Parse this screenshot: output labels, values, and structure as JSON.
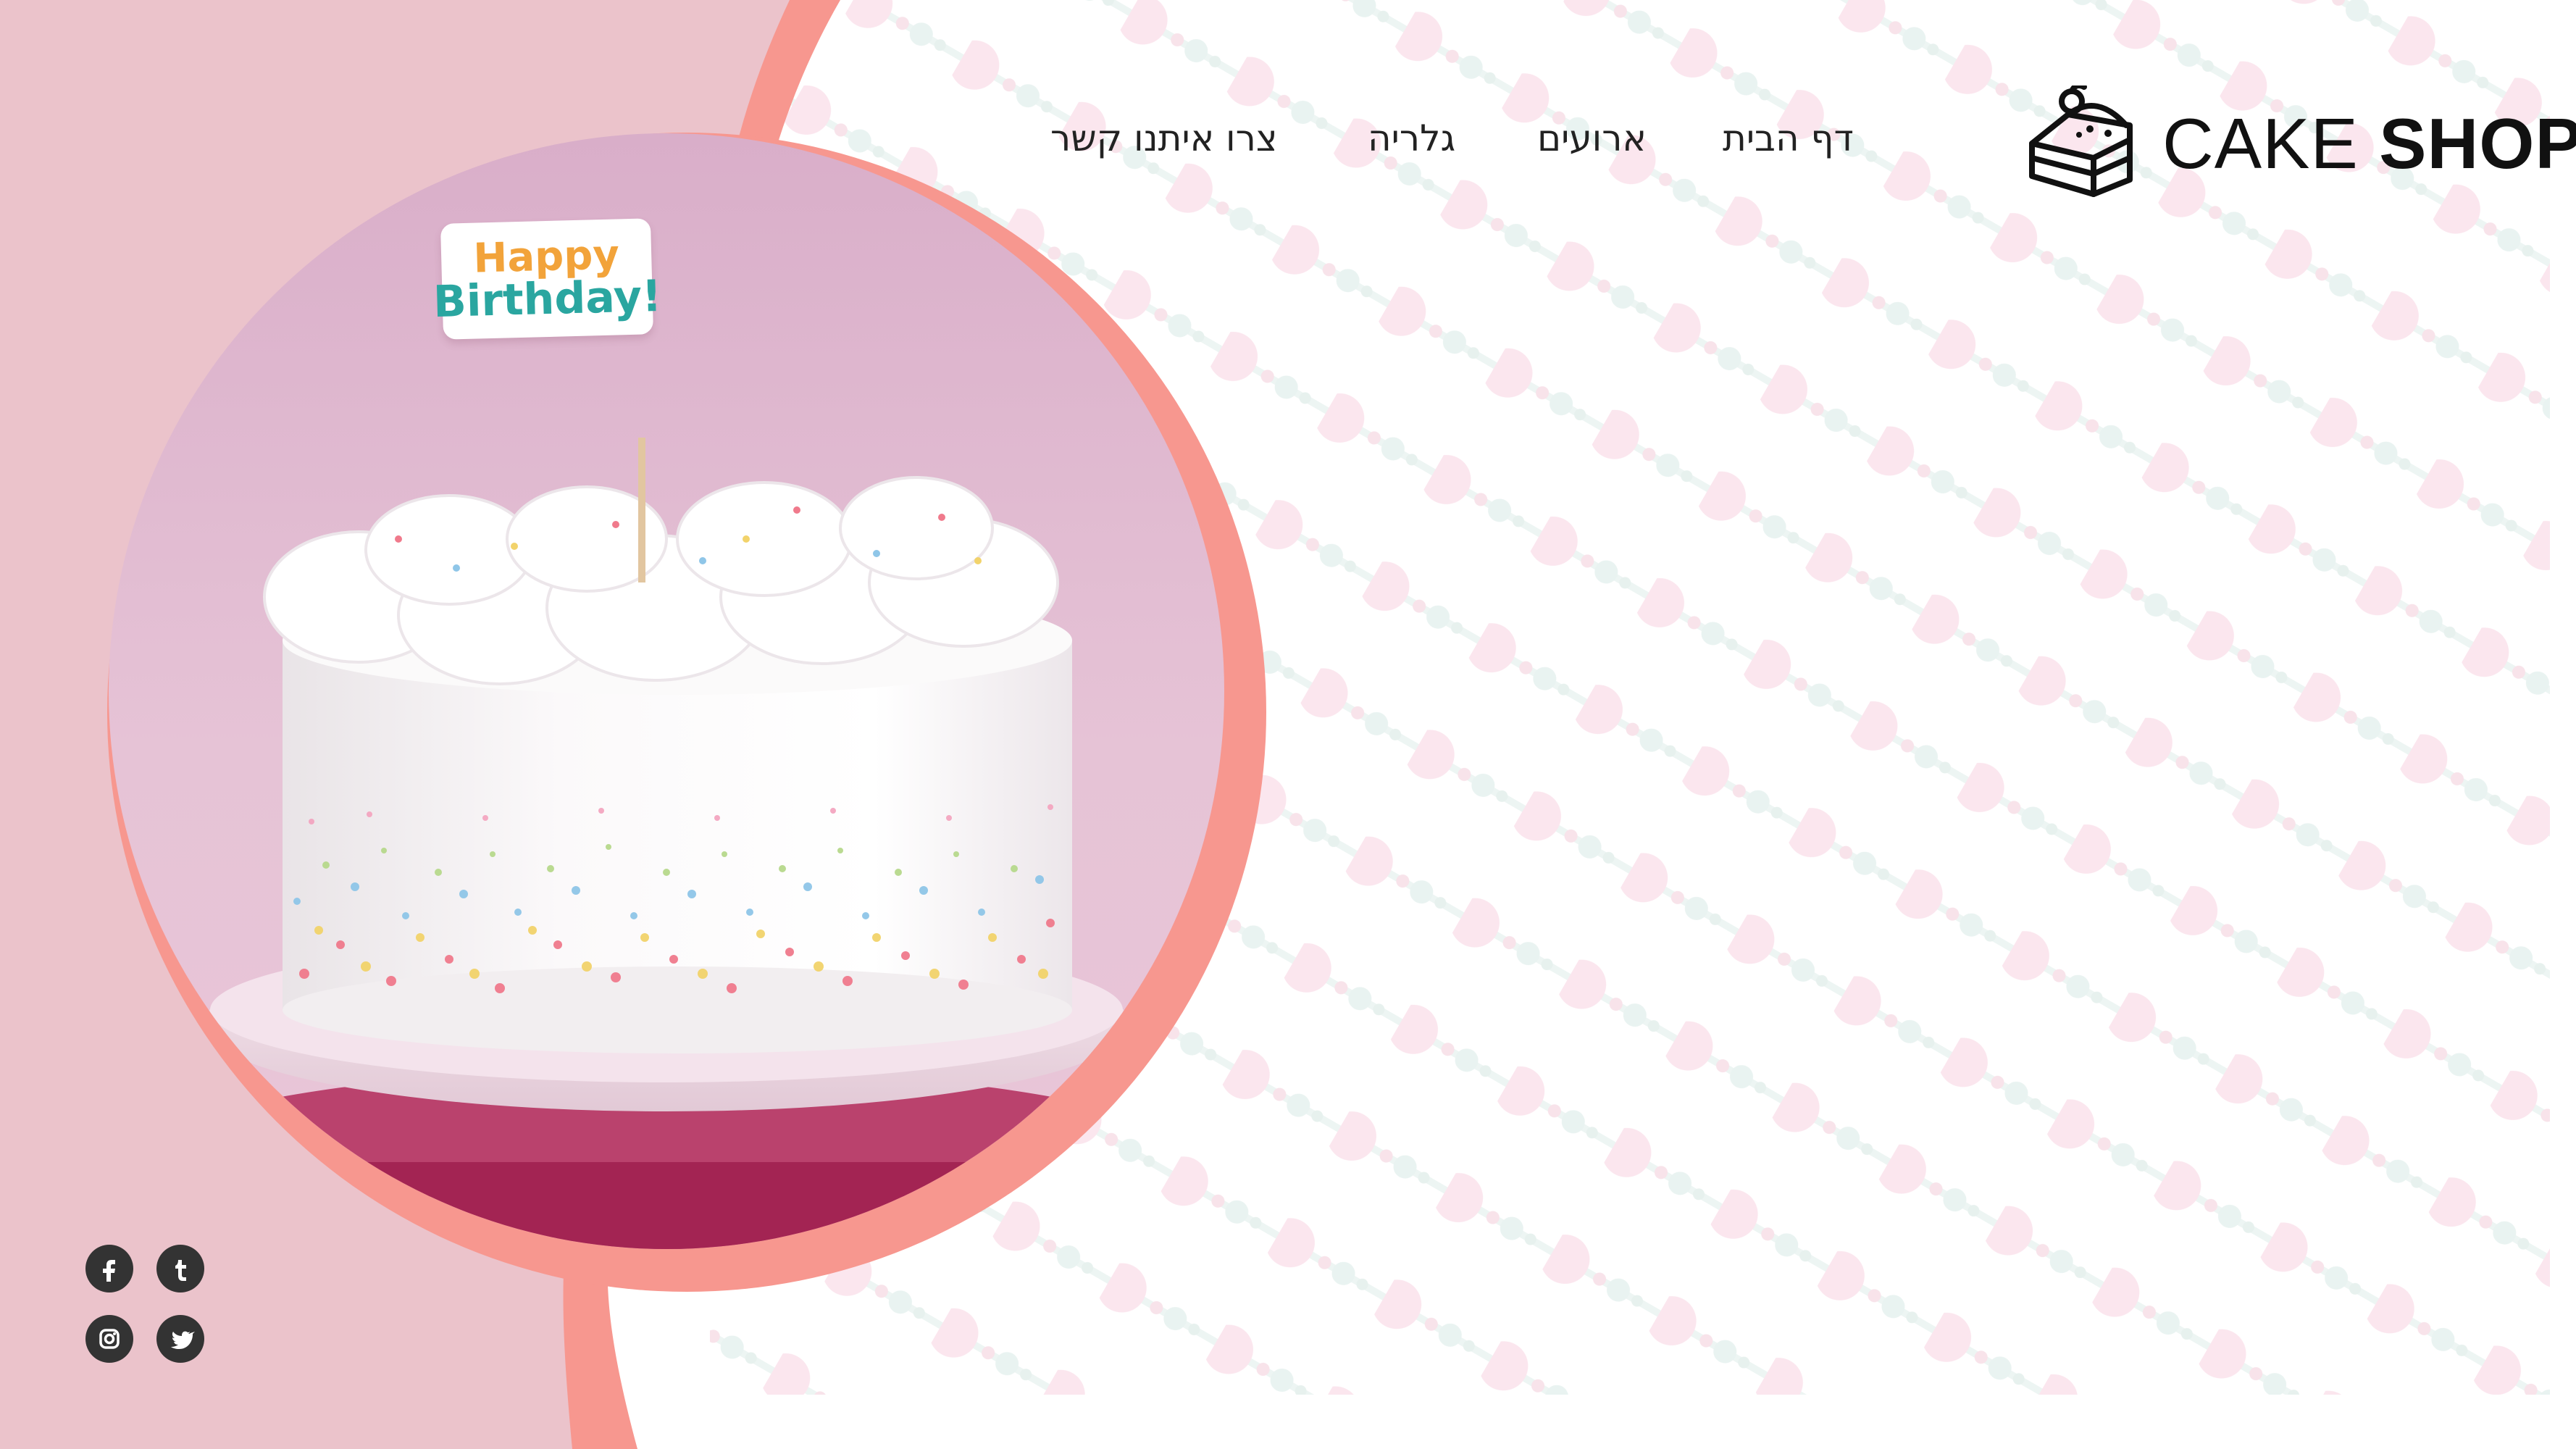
{
  "brand": {
    "name_light": "CAKE",
    "name_bold": "SHOP",
    "logo_icon": "cake-slice-icon"
  },
  "nav": {
    "items": [
      {
        "label": "דף הבית",
        "icon": ""
      },
      {
        "label": "ארועים",
        "icon": ""
      },
      {
        "label": "גלריה",
        "icon": ""
      },
      {
        "label": "צרו איתנו קשר",
        "icon": ""
      }
    ]
  },
  "hero": {
    "image_alt": "white birthday cake with sprinkles",
    "topper_line1": "Happy",
    "topper_line2": "Birthday!"
  },
  "social": [
    {
      "name": "facebook",
      "icon": "facebook-icon"
    },
    {
      "name": "tumblr",
      "icon": "tumblr-icon"
    },
    {
      "name": "instagram",
      "icon": "instagram-icon"
    },
    {
      "name": "twitter",
      "icon": "twitter-icon"
    }
  ],
  "colors": {
    "left_panel": "#ebc3cb",
    "accent_band": "#f7978f",
    "pattern_dot": "#fbe6ee",
    "pattern_line": "#edf5f3",
    "nav_text": "#222222",
    "social_bg": "#333333"
  }
}
